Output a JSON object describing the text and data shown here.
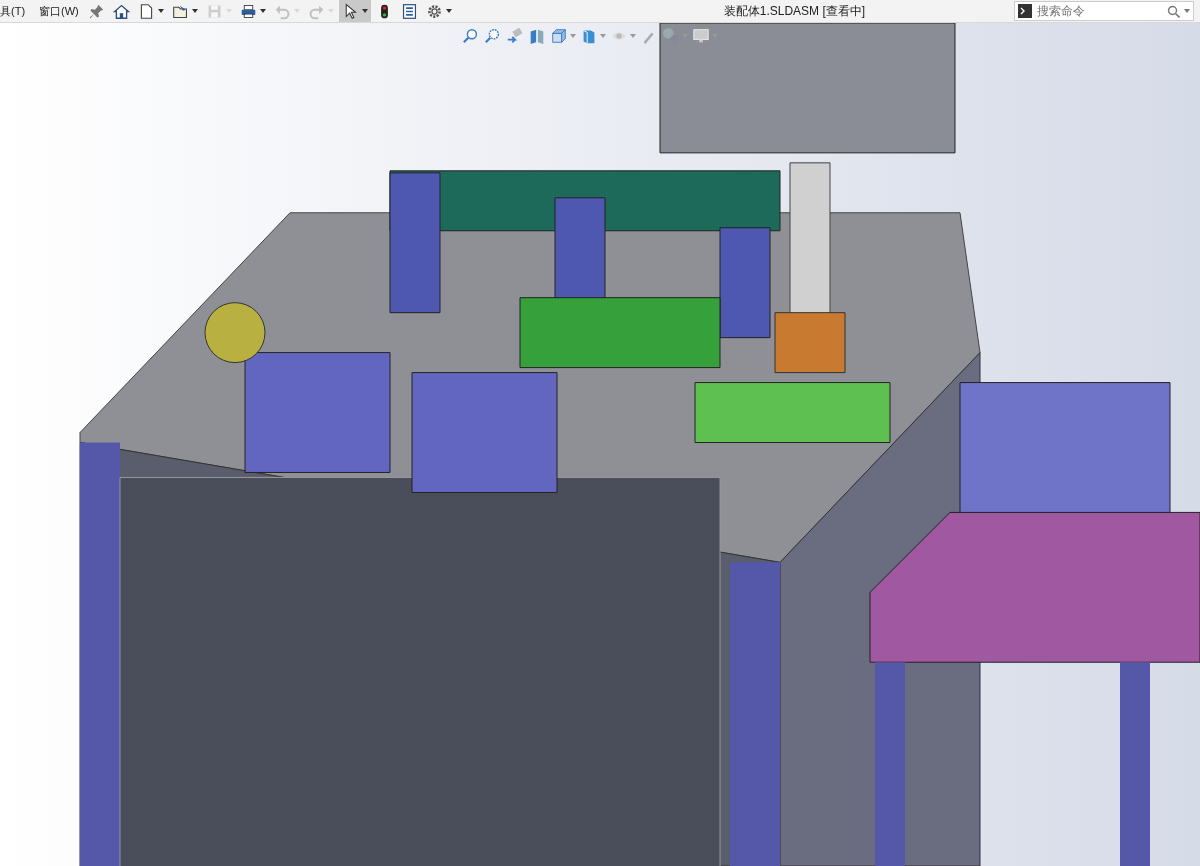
{
  "menu": [
    {
      "label": "具(T)"
    },
    {
      "label": "窗口(W)"
    }
  ],
  "toolbar": [
    {
      "kind": "pin",
      "disabled": false,
      "selected": false
    },
    {
      "kind": "home",
      "disabled": false,
      "selected": false
    },
    {
      "kind": "new",
      "disabled": false,
      "selected": false
    },
    {
      "kind": "open",
      "disabled": false,
      "selected": false
    },
    {
      "kind": "save",
      "disabled": true,
      "selected": false
    },
    {
      "kind": "print",
      "disabled": false,
      "selected": false
    },
    {
      "kind": "undo",
      "disabled": true,
      "selected": false
    },
    {
      "kind": "redo",
      "disabled": true,
      "selected": false
    },
    {
      "kind": "select",
      "disabled": false,
      "selected": true
    },
    {
      "kind": "rebuild",
      "disabled": false,
      "selected": false
    },
    {
      "kind": "properties",
      "disabled": false,
      "selected": false
    },
    {
      "kind": "options",
      "disabled": false,
      "selected": false
    }
  ],
  "window": {
    "title": "装配体1.SLDASM [查看中]"
  },
  "search": {
    "placeholder": "搜索命令"
  },
  "view_toolbar": [
    {
      "kind": "zoom-fit"
    },
    {
      "kind": "zoom-area"
    },
    {
      "kind": "previous-view"
    },
    {
      "kind": "section"
    },
    {
      "kind": "orientation"
    },
    {
      "kind": "display-style"
    },
    {
      "kind": "hide-show"
    },
    {
      "kind": "appearance"
    },
    {
      "kind": "scene"
    },
    {
      "kind": "view-settings"
    }
  ]
}
